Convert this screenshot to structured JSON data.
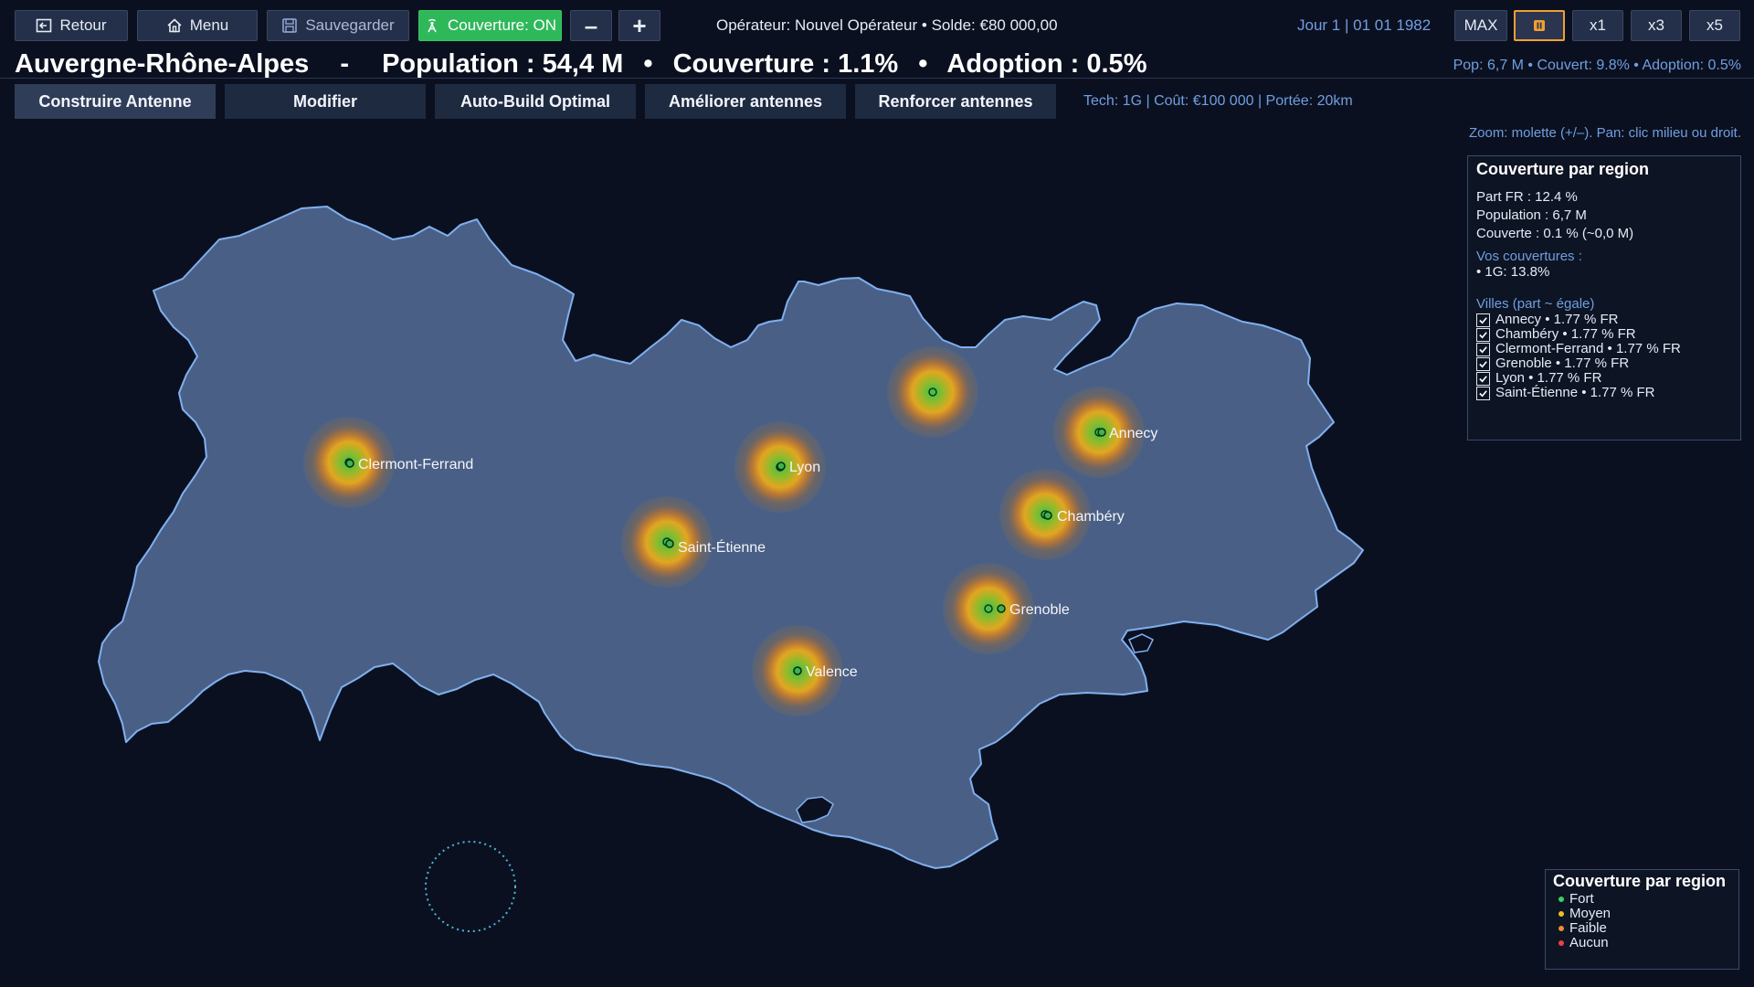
{
  "toolbar": {
    "back_label": "Retour",
    "menu_label": "Menu",
    "save_label": "Sauvegarder",
    "coverage_toggle_label": "Couverture: ON",
    "zoom_out_label": "–",
    "zoom_in_label": "+",
    "operator_text": "Opérateur: Nouvel Opérateur  •  Solde: €80 000,00",
    "date_text": "Jour 1  |  01 01 1982",
    "speed_max_label": "MAX",
    "speed_x1_label": "x1",
    "speed_x3_label": "x3",
    "speed_x5_label": "x5"
  },
  "header": {
    "region_name": "Auvergne-Rhône-Alpes",
    "separator": "-",
    "population": "Population : 54,4 M",
    "dot1": "•",
    "coverage": "Couverture : 1.1%",
    "dot2": "•",
    "adoption": "Adoption : 0.5%",
    "right_stats": "Pop: 6,7 M  •  Couvert: 9.8%  •  Adoption: 0.5%"
  },
  "actions": {
    "build_label": "Construire Antenne",
    "modify_label": "Modifier",
    "autobuild_label": "Auto-Build Optimal",
    "upgrade_label": "Améliorer antennes",
    "reinforce_label": "Renforcer antennes",
    "tech_info": "Tech: 1G | Coût: €100 000 | Portée: 20km",
    "zoom_hint": "Zoom: molette (+/–). Pan: clic milieu ou droit."
  },
  "map": {
    "cities": [
      {
        "name": "Clermont-Ferrand"
      },
      {
        "name": "Lyon"
      },
      {
        "name": "Saint-Étienne"
      },
      {
        "name": "Annecy"
      },
      {
        "name": "Chambéry"
      },
      {
        "name": "Grenoble"
      },
      {
        "name": "Valence"
      }
    ],
    "colors": {
      "region_fill": "#4a5f85",
      "region_border": "#6f9fe0",
      "antenna_core": "#3bb54a",
      "antenna_mid": "#e0a020",
      "antenna_outer": "#b07030"
    }
  },
  "info_panel": {
    "title": "Couverture par region",
    "share": "Part FR : 12.4 %",
    "population": "Population : 6,7 M",
    "covered": "Couverte : 0.1 % (~0,0 M)",
    "your_coverages_title": "Vos couvertures :",
    "your_coverages": "• 1G: 13.8%",
    "cities_title": "Villes (part ~ égale)",
    "cities": [
      {
        "label": "Annecy • 1.77 % FR",
        "checked": true
      },
      {
        "label": "Chambéry • 1.77 % FR",
        "checked": true
      },
      {
        "label": "Clermont-Ferrand • 1.77 % FR",
        "checked": true
      },
      {
        "label": "Grenoble • 1.77 % FR",
        "checked": true
      },
      {
        "label": "Lyon • 1.77 % FR",
        "checked": true
      },
      {
        "label": "Saint-Étienne • 1.77 % FR",
        "checked": true
      }
    ]
  },
  "legend": {
    "title": "Couverture par region",
    "items": [
      {
        "label": "Fort",
        "color": "#3bd060"
      },
      {
        "label": "Moyen",
        "color": "#e8c020"
      },
      {
        "label": "Faible",
        "color": "#f08a30"
      },
      {
        "label": "Aucun",
        "color": "#f04040"
      }
    ]
  }
}
